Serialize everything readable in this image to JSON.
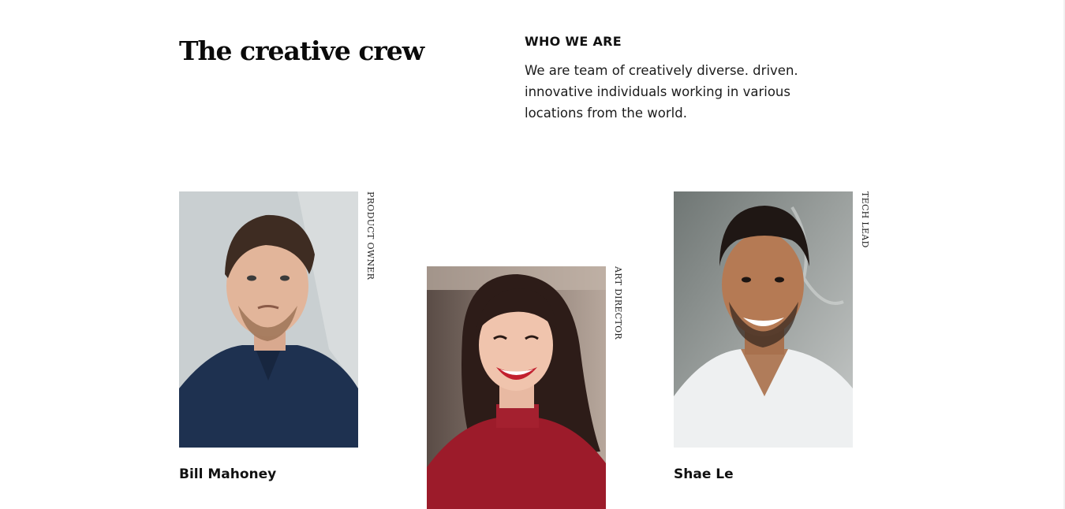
{
  "section": {
    "title": "The creative crew",
    "intro_heading": "WHO WE ARE",
    "intro_text": "We are team of creatively diverse. driven. innovative individuals working in various locations from the world."
  },
  "members": [
    {
      "name": "Bill Mahoney",
      "role": "PRODUCT OWNER",
      "photo_icon": "portrait-man-navy-polo"
    },
    {
      "name": "",
      "role": "ART DIRECTOR",
      "photo_icon": "portrait-woman-red-sweater"
    },
    {
      "name": "Shae Le",
      "role": "TECH LEAD",
      "photo_icon": "portrait-man-white-tshirt"
    }
  ],
  "colors": {
    "text": "#111111",
    "background": "#ffffff",
    "photo1_background": "#c9cfd1",
    "photo2_background": "#7d6f67",
    "photo3_background": "#8a8f8d"
  }
}
